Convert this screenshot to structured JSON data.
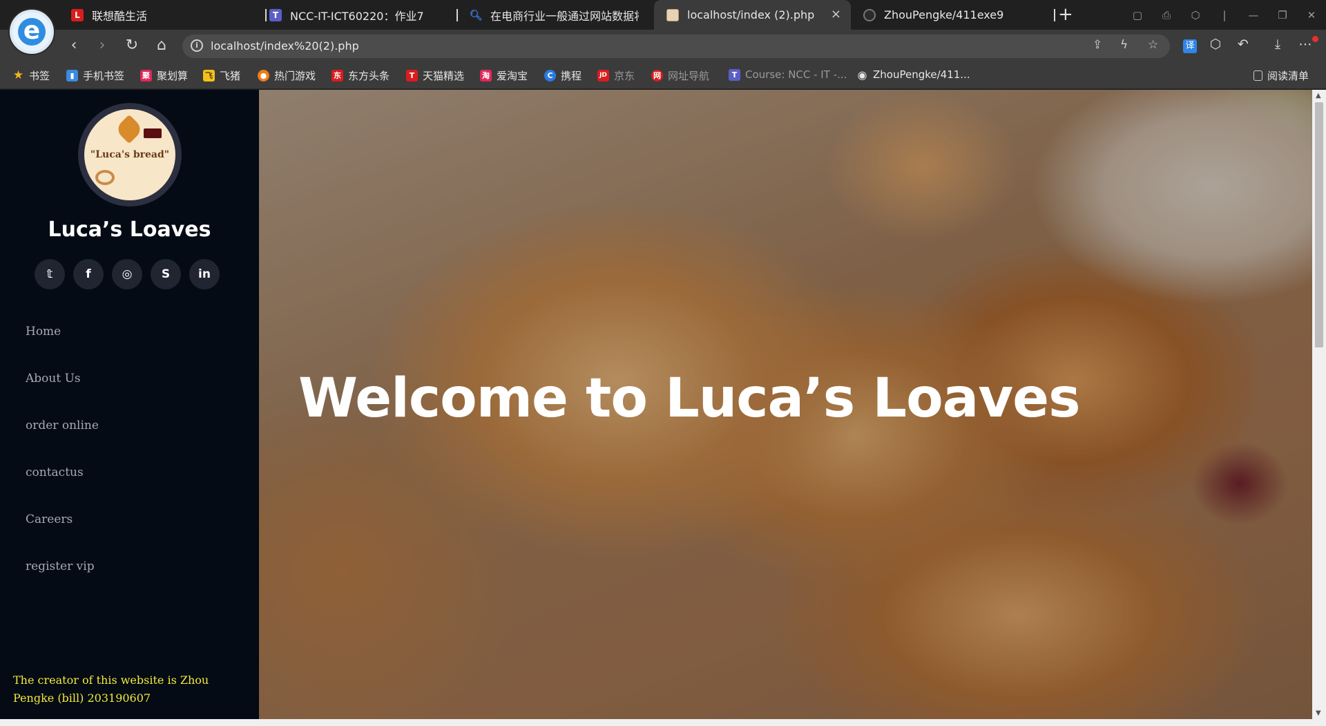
{
  "browser": {
    "tabs": [
      {
        "label": "联想酷生活",
        "icon_color": "#d91d1d",
        "icon_char": "L"
      },
      {
        "label": "NCC-IT-ICT60220：作业7",
        "icon_color": "#5a5fc8",
        "icon_char": "T"
      },
      {
        "label": "在电商行业一般通过网站数据将",
        "icon_color": "#3b7be0",
        "icon_char": "Q"
      },
      {
        "label": "localhost/index (2).php",
        "icon_color": "#e7d3b3",
        "icon_char": ""
      },
      {
        "label": "ZhouPengke/411exe9",
        "icon_color": "#555555",
        "icon_char": ""
      }
    ],
    "new_tab": "+",
    "close_tab": "×",
    "url": "localhost/index%20(2).php",
    "info_icon": "i",
    "nav_icons": {
      "back": "‹",
      "forward": "›",
      "reload": "↻",
      "home": "⌂"
    },
    "toolbar_icons": {
      "share": "⇪",
      "bolt": "ϟ",
      "star": "☆",
      "translate": "译",
      "extension": "⬡",
      "undo": "↶",
      "download": "⤓",
      "more": "⋯"
    },
    "window_controls": [
      "▢",
      "⎙",
      "⬡",
      "|",
      "—",
      "❐",
      "✕"
    ],
    "bookmarks": [
      {
        "label": "书签",
        "icon_color": "#f2b51a",
        "icon_char": "★"
      },
      {
        "label": "手机书签",
        "icon_color": "#3a8be0",
        "icon_char": "▮"
      },
      {
        "label": "聚划算",
        "icon_color": "#e0285a",
        "icon_char": "聚"
      },
      {
        "label": "飞猪",
        "icon_color": "#f2c21a",
        "icon_char": "飞"
      },
      {
        "label": "热门游戏",
        "icon_color": "#f07d1a",
        "icon_char": "●"
      },
      {
        "label": "东方头条",
        "icon_color": "#d91d1d",
        "icon_char": "东"
      },
      {
        "label": "天猫精选",
        "icon_color": "#d91d1d",
        "icon_char": "T"
      },
      {
        "label": "爱淘宝",
        "icon_color": "#e0285a",
        "icon_char": "淘"
      },
      {
        "label": "携程",
        "icon_color": "#2a7be0",
        "icon_char": "C"
      },
      {
        "label": "京东",
        "icon_color": "#d91d1d",
        "icon_char": "JD"
      },
      {
        "label": "网址导航",
        "icon_color": "#d91d1d",
        "icon_char": "网"
      },
      {
        "label": "Course: NCC - IT -...",
        "icon_color": "#5a5fc8",
        "icon_char": "T"
      },
      {
        "label": "ZhouPengke/411...",
        "icon_color": "#555555",
        "icon_char": "◉"
      }
    ],
    "reading_list": "阅读清单"
  },
  "sidebar": {
    "logo_text": "\"Luca's bread\"",
    "site_name": "Luca’s Loaves",
    "socials": [
      {
        "name": "twitter",
        "glyph": "𝕥"
      },
      {
        "name": "facebook",
        "glyph": "f"
      },
      {
        "name": "instagram",
        "glyph": "◎"
      },
      {
        "name": "skype",
        "glyph": "S"
      },
      {
        "name": "linkedin",
        "glyph": "in"
      }
    ],
    "nav": [
      "Home",
      "About Us",
      "order online",
      "contactus",
      "Careers",
      "register vip"
    ],
    "creator_note": "The creator of this website is Zhou Pengke (bill) 203190607"
  },
  "hero": {
    "title": "Welcome to Luca’s Loaves"
  },
  "scrollbar": {
    "up": "▲",
    "down": "▼"
  }
}
